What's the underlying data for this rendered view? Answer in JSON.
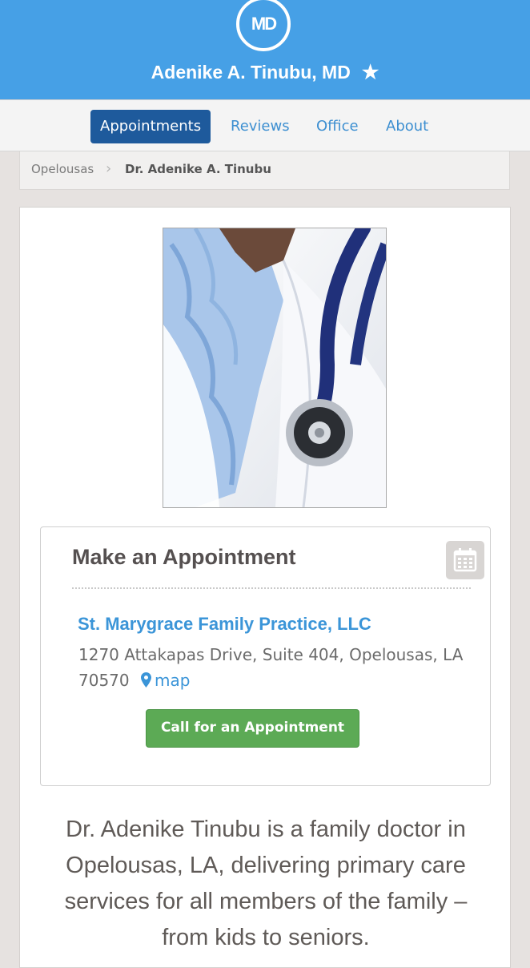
{
  "header": {
    "logo_text": "MD",
    "title": "Adenike A. Tinubu, MD",
    "favorite_icon": "star-icon",
    "bg_color": "#46a0e6"
  },
  "nav": {
    "items": [
      {
        "label": "Appointments",
        "active": true
      },
      {
        "label": "Reviews",
        "active": false
      },
      {
        "label": "Office",
        "active": false
      },
      {
        "label": "About",
        "active": false
      }
    ]
  },
  "breadcrumb": {
    "items": [
      "Opelousas",
      "Dr. Adenike A. Tinubu"
    ],
    "separator_icon": "chevron-right-icon"
  },
  "appointment": {
    "title": "Make an Appointment",
    "calendar_icon": "calendar-icon",
    "practice_name": "St. Marygrace Family Practice, LLC",
    "address": "1270 Attakapas Drive, Suite 404, Opelousas, LA 70570",
    "map_label": "map",
    "map_icon": "map-marker-icon",
    "call_button_label": "Call for an Appointment",
    "call_button_color": "#5caa55"
  },
  "description": "Dr. Adenike Tinubu is a family doctor in Opelousas, LA, delivering primary care services for all members of the family – from kids to seniors."
}
